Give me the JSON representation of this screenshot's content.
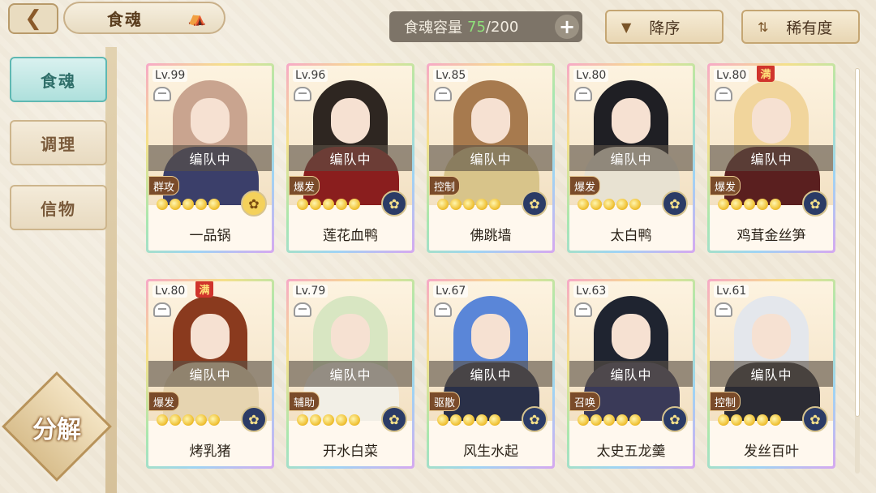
{
  "header": {
    "title": "食魂",
    "capacity_label": "食魂容量",
    "capacity_current": "75",
    "capacity_max": "/200",
    "sort_order_label": "降序",
    "sort_field_label": "稀有度"
  },
  "sidebar": {
    "tabs": [
      {
        "label": "食魂",
        "active": true
      },
      {
        "label": "调理",
        "active": false
      },
      {
        "label": "信物",
        "active": false
      }
    ],
    "decompose_label": "分解"
  },
  "colors": {
    "accent_teal": "#5fb8b2",
    "capacity_green": "#8fe07a",
    "brand_brown": "#8a5a2a"
  },
  "cards": [
    {
      "level": "Lv.99",
      "status": "编队中",
      "role": "群攻",
      "name": "一品锅",
      "stars": 5,
      "maxed": false,
      "emblem": "gold"
    },
    {
      "level": "Lv.96",
      "status": "编队中",
      "role": "爆发",
      "name": "莲花血鸭",
      "stars": 5,
      "maxed": false,
      "emblem": "dark"
    },
    {
      "level": "Lv.85",
      "status": "编队中",
      "role": "控制",
      "name": "佛跳墙",
      "stars": 5,
      "maxed": false,
      "emblem": "dark"
    },
    {
      "level": "Lv.80",
      "status": "编队中",
      "role": "爆发",
      "name": "太白鸭",
      "stars": 5,
      "maxed": false,
      "emblem": "dark"
    },
    {
      "level": "Lv.80",
      "status": "编队中",
      "role": "爆发",
      "name": "鸡茸金丝笋",
      "stars": 5,
      "maxed": true,
      "maxed_label": "满",
      "emblem": "dark"
    },
    {
      "level": "Lv.80",
      "status": "编队中",
      "role": "爆发",
      "name": "烤乳猪",
      "stars": 5,
      "maxed": true,
      "maxed_label": "满",
      "emblem": "dark"
    },
    {
      "level": "Lv.79",
      "status": "编队中",
      "role": "辅助",
      "name": "开水白菜",
      "stars": 5,
      "maxed": false,
      "emblem": "dark"
    },
    {
      "level": "Lv.67",
      "status": "编队中",
      "role": "驱散",
      "name": "风生水起",
      "stars": 5,
      "maxed": false,
      "emblem": "dark"
    },
    {
      "level": "Lv.63",
      "status": "编队中",
      "role": "召唤",
      "name": "太史五龙羹",
      "stars": 5,
      "maxed": false,
      "emblem": "dark"
    },
    {
      "level": "Lv.61",
      "status": "编队中",
      "role": "控制",
      "name": "发丝百叶",
      "stars": 5,
      "maxed": false,
      "emblem": "dark"
    }
  ]
}
